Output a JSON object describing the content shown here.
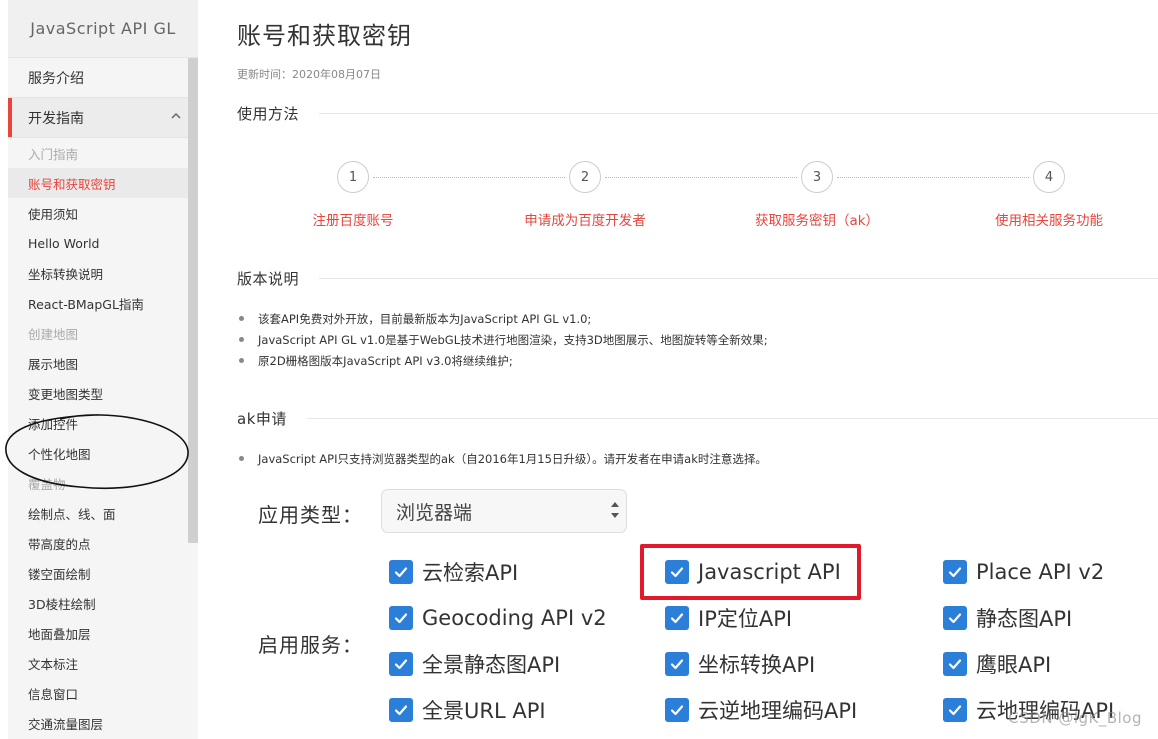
{
  "sidebar": {
    "logo": "JavaScript API GL",
    "group_service": "服务介绍",
    "group_dev": "开发指南",
    "items": [
      {
        "label": "入门指南",
        "style": "muted"
      },
      {
        "label": "账号和获取密钥",
        "style": "current"
      },
      {
        "label": "使用须知",
        "style": "normal"
      },
      {
        "label": "Hello World",
        "style": "normal"
      },
      {
        "label": "坐标转换说明",
        "style": "normal"
      },
      {
        "label": "React-BMapGL指南",
        "style": "normal"
      },
      {
        "label": "创建地图",
        "style": "muted"
      },
      {
        "label": "展示地图",
        "style": "normal"
      },
      {
        "label": "变更地图类型",
        "style": "normal"
      },
      {
        "label": "添加控件",
        "style": "normal"
      },
      {
        "label": "个性化地图",
        "style": "normal"
      },
      {
        "label": "覆盖物",
        "style": "muted"
      },
      {
        "label": "绘制点、线、面",
        "style": "normal"
      },
      {
        "label": "带高度的点",
        "style": "normal"
      },
      {
        "label": "镂空面绘制",
        "style": "normal"
      },
      {
        "label": "3D棱柱绘制",
        "style": "normal"
      },
      {
        "label": "地面叠加层",
        "style": "normal"
      },
      {
        "label": "文本标注",
        "style": "normal"
      },
      {
        "label": "信息窗口",
        "style": "normal"
      },
      {
        "label": "交通流量图层",
        "style": "normal"
      }
    ]
  },
  "main": {
    "title": "账号和获取密钥",
    "updated": "更新时间：2020年08月07日",
    "usage_title": "使用方法",
    "steps": [
      {
        "num": "1",
        "label": "注册百度账号"
      },
      {
        "num": "2",
        "label": "申请成为百度开发者"
      },
      {
        "num": "3",
        "label": "获取服务密钥（ak）"
      },
      {
        "num": "4",
        "label": "使用相关服务功能"
      }
    ],
    "version_title": "版本说明",
    "version_notes": [
      "该套API免费对外开放，目前最新版本为JavaScript API GL v1.0;",
      "JavaScript API GL v1.0是基于WebGL技术进行地图渲染，支持3D地图展示、地图旋转等全新效果;",
      "原2D栅格图版本JavaScript API v3.0将继续维护;"
    ],
    "ak_title": "ak申请",
    "ak_notes": [
      "JavaScript API只支持浏览器类型的ak（自2016年1月15日升级）。请开发者在申请ak时注意选择。"
    ],
    "form": {
      "app_type_label": "应用类型：",
      "app_type_value": "浏览器端",
      "services_label": "启用服务：",
      "services": [
        "云检索API",
        "Javascript API",
        "Place API v2",
        "Geocoding API v2",
        "IP定位API",
        "静态图API",
        "全景静态图API",
        "坐标转换API",
        "鹰眼API",
        "全景URL API",
        "云逆地理编码API",
        "云地理编码API"
      ]
    }
  },
  "colors": {
    "accent": "#e8453c",
    "checkbox": "#2c7fd9",
    "highlight": "#e01a2b"
  },
  "watermark": "CSDN @lgK_Blog"
}
